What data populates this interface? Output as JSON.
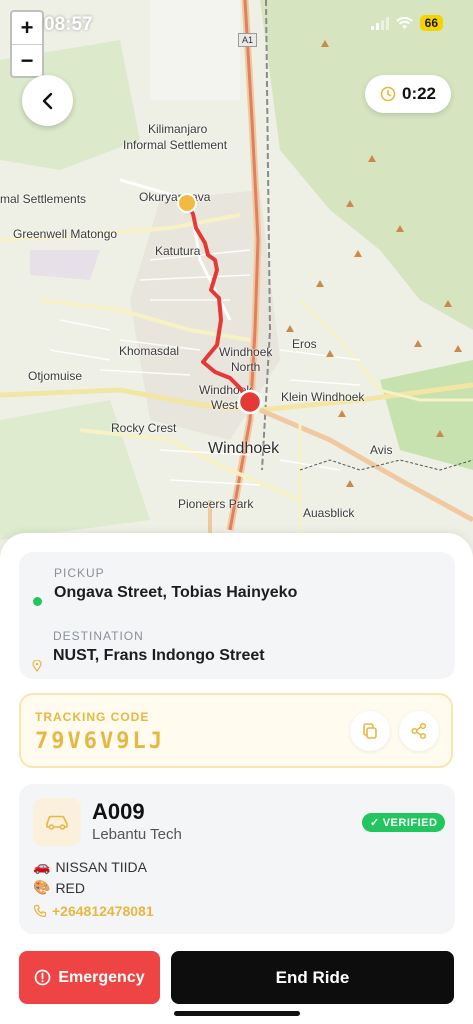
{
  "status_bar": {
    "time": "08:57",
    "battery": "66"
  },
  "map": {
    "zoom_in": "+",
    "zoom_out": "−",
    "road_shield": "A1",
    "labels": [
      "Kilimanjaro",
      "Informal Settlement",
      "mal Settlements",
      "Okuryangava",
      "Greenwell Matongo",
      "Katutura",
      "Eros",
      "Khomasdal",
      "Windhoek",
      "North",
      "Otjomuise",
      "Windhoek",
      "West",
      "Klein Windhoek",
      "Rocky Crest",
      "Windhoek",
      "Avis",
      "Pioneers Park",
      "Auasblick"
    ],
    "colors": {
      "route": "#e53935",
      "pickup_marker": "#f4b942",
      "destination_marker": "#e53935"
    }
  },
  "header": {
    "back_icon": "chevron-left-icon",
    "timer": "0:22",
    "timer_icon": "clock-icon"
  },
  "trip": {
    "pickup_label": "PICKUP",
    "pickup_address": "Ongava Street, Tobias Hainyeko",
    "destination_label": "DESTINATION",
    "destination_address": "NUST, Frans Indongo Street"
  },
  "tracking": {
    "label": "TRACKING CODE",
    "code": "79V6V9LJ",
    "copy_icon": "copy-icon",
    "share_icon": "share-icon"
  },
  "driver": {
    "id": "A009",
    "company": "Lebantu Tech",
    "verified": "VERIFIED",
    "vehicle": "NISSAN TIIDA",
    "vehicle_emoji": "🚗",
    "color": "RED",
    "color_emoji": "🎨",
    "phone": "+264812478081"
  },
  "actions": {
    "emergency": "Emergency",
    "end_ride": "End Ride"
  },
  "colors": {
    "accent": "#e6b742",
    "danger": "#ef4444",
    "success": "#22c55e",
    "dark": "#0d0d0d"
  }
}
